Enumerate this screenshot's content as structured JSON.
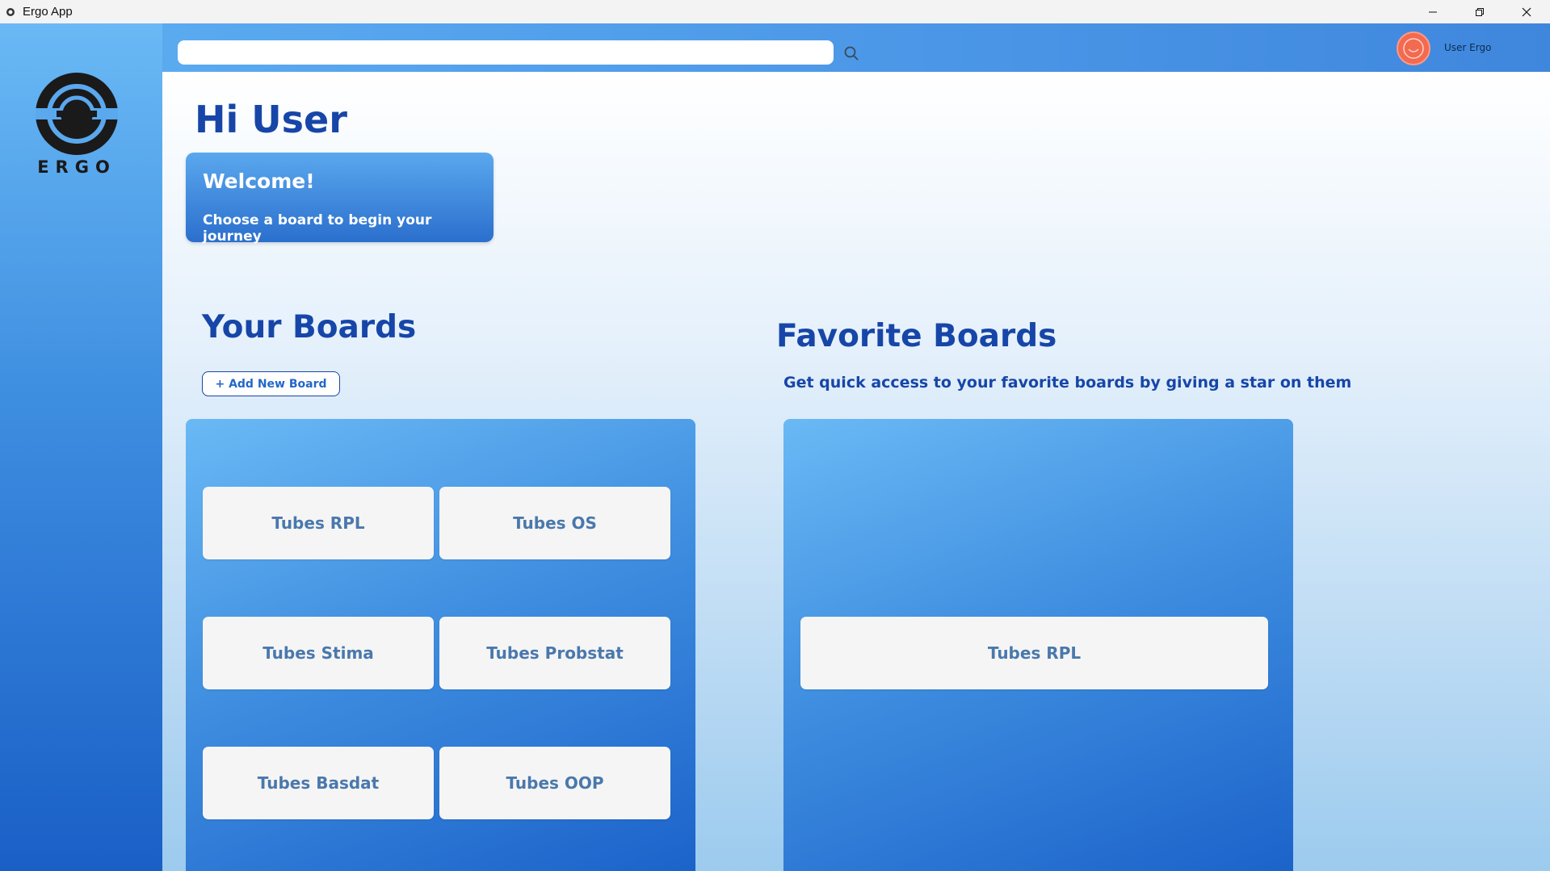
{
  "window": {
    "title": "Ergo App",
    "controls": {
      "minimize": "minimize-icon",
      "restore": "restore-icon",
      "close": "close-icon"
    }
  },
  "sidebar": {
    "logo_text": "ERGO"
  },
  "header": {
    "search": {
      "value": "",
      "placeholder": ""
    },
    "user_name": "User Ergo",
    "avatar_color": "#f26a50"
  },
  "main": {
    "greeting": "Hi User",
    "welcome": {
      "title": "Welcome!",
      "subtitle": "Choose a board to begin your journey"
    },
    "your_boards": {
      "title": "Your Boards",
      "add_button": "+ Add New Board",
      "boards": [
        "Tubes RPL",
        "Tubes OS",
        "Tubes Stima",
        "Tubes Probstat",
        "Tubes Basdat",
        "Tubes OOP"
      ]
    },
    "favorite_boards": {
      "title": "Favorite Boards",
      "subtitle": "Get quick access to your favorite boards by giving a star on them",
      "boards": [
        "Tubes RPL"
      ]
    }
  },
  "colors": {
    "accent": "#1746a8",
    "panel_top": "#6ab9f5",
    "panel_bottom": "#1a61c9",
    "card_text": "#4a78ac"
  }
}
